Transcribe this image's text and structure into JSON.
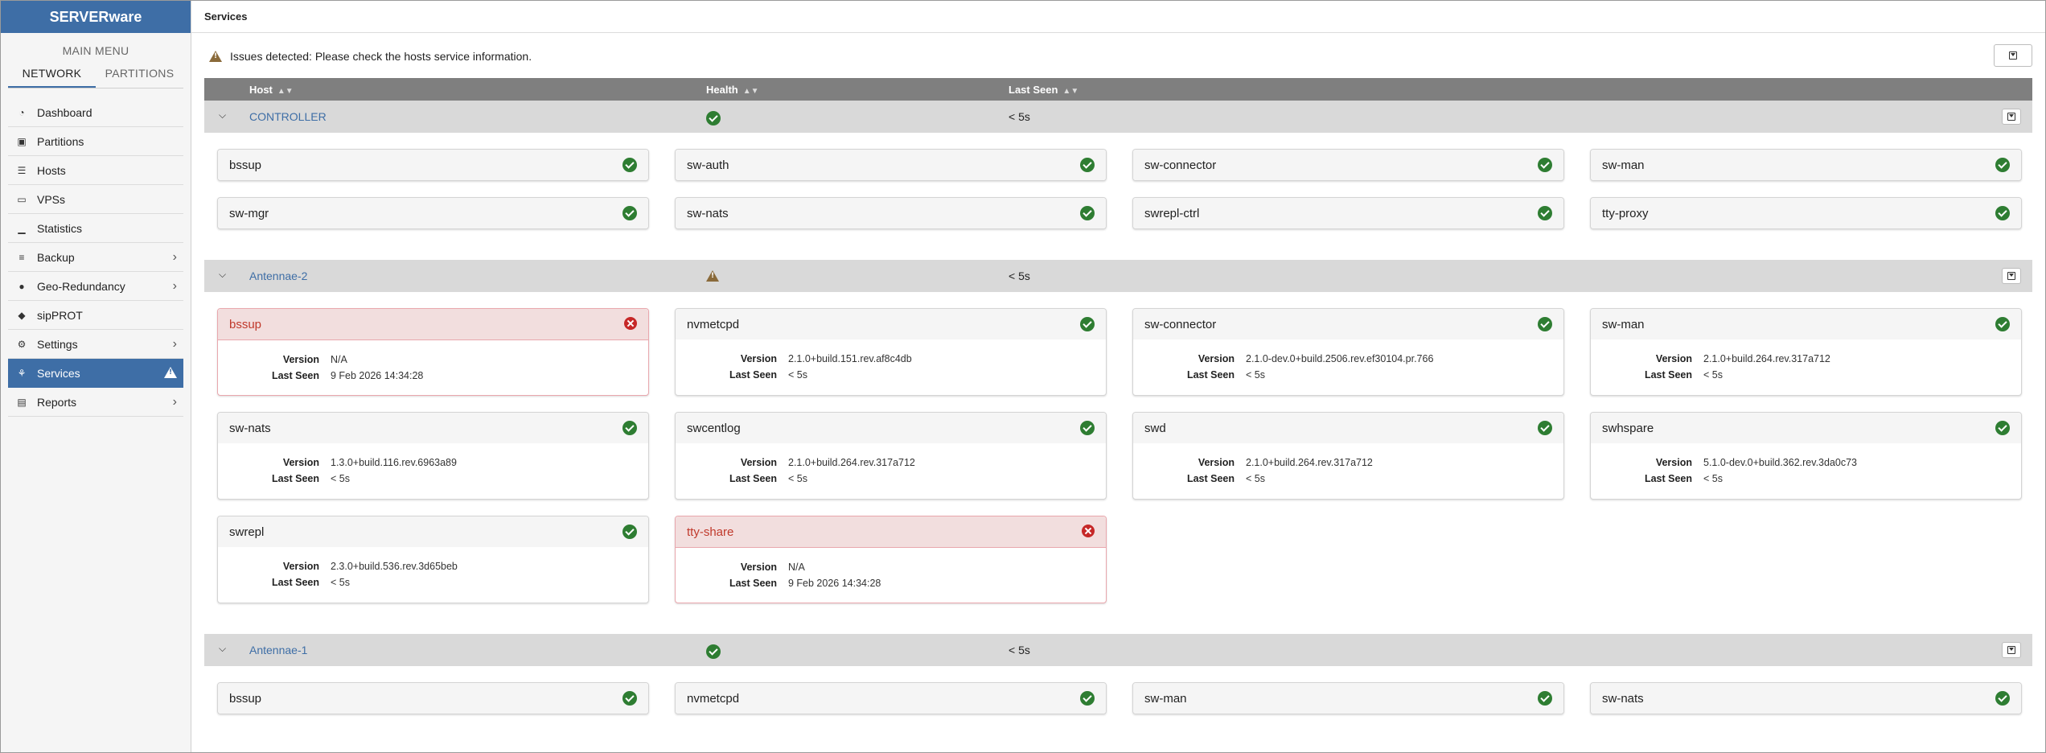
{
  "app": {
    "brand": "SERVERware"
  },
  "sidebar": {
    "menu_title": "MAIN MENU",
    "tabs": [
      {
        "label": "NETWORK",
        "active": true
      },
      {
        "label": "PARTITIONS",
        "active": false
      }
    ],
    "items": [
      {
        "label": "Dashboard",
        "icon": "dashboard-icon"
      },
      {
        "label": "Partitions",
        "icon": "partitions-icon"
      },
      {
        "label": "Hosts",
        "icon": "hosts-icon"
      },
      {
        "label": "VPSs",
        "icon": "laptop-icon"
      },
      {
        "label": "Statistics",
        "icon": "chart-icon"
      },
      {
        "label": "Backup",
        "icon": "database-icon",
        "submenu": true
      },
      {
        "label": "Geo-Redundancy",
        "icon": "globe-icon",
        "submenu": true
      },
      {
        "label": "sipPROT",
        "icon": "shield-icon"
      },
      {
        "label": "Settings",
        "icon": "gears-icon",
        "submenu": true
      },
      {
        "label": "Services",
        "icon": "services-icon",
        "active": true,
        "warning": true
      },
      {
        "label": "Reports",
        "icon": "report-icon",
        "submenu": true
      }
    ]
  },
  "header": {
    "title": "Services"
  },
  "alert": {
    "text": "Issues detected: Please check the hosts service information."
  },
  "table": {
    "columns": {
      "host": "Host",
      "health": "Health",
      "last_seen": "Last Seen"
    }
  },
  "hosts": [
    {
      "name": "CONTROLLER",
      "health": "ok",
      "last_seen": "< 5s",
      "services": [
        {
          "name": "bssup",
          "status": "ok"
        },
        {
          "name": "sw-auth",
          "status": "ok"
        },
        {
          "name": "sw-connector",
          "status": "ok"
        },
        {
          "name": "sw-man",
          "status": "ok"
        },
        {
          "name": "sw-mgr",
          "status": "ok"
        },
        {
          "name": "sw-nats",
          "status": "ok"
        },
        {
          "name": "swrepl-ctrl",
          "status": "ok"
        },
        {
          "name": "tty-proxy",
          "status": "ok"
        }
      ]
    },
    {
      "name": "Antennae-2",
      "health": "warning",
      "last_seen": "< 5s",
      "services": [
        {
          "name": "bssup",
          "status": "error",
          "version": "N/A",
          "last_seen": "9 Feb 2026 14:34:28"
        },
        {
          "name": "nvmetcpd",
          "status": "ok",
          "version": "2.1.0+build.151.rev.af8c4db",
          "last_seen": "< 5s"
        },
        {
          "name": "sw-connector",
          "status": "ok",
          "version": "2.1.0-dev.0+build.2506.rev.ef30104.pr.766",
          "last_seen": "< 5s"
        },
        {
          "name": "sw-man",
          "status": "ok",
          "version": "2.1.0+build.264.rev.317a712",
          "last_seen": "< 5s"
        },
        {
          "name": "sw-nats",
          "status": "ok",
          "version": "1.3.0+build.116.rev.6963a89",
          "last_seen": "< 5s"
        },
        {
          "name": "swcentlog",
          "status": "ok",
          "version": "2.1.0+build.264.rev.317a712",
          "last_seen": "< 5s"
        },
        {
          "name": "swd",
          "status": "ok",
          "version": "2.1.0+build.264.rev.317a712",
          "last_seen": "< 5s"
        },
        {
          "name": "swhspare",
          "status": "ok",
          "version": "5.1.0-dev.0+build.362.rev.3da0c73",
          "last_seen": "< 5s"
        },
        {
          "name": "swrepl",
          "status": "ok",
          "version": "2.3.0+build.536.rev.3d65beb",
          "last_seen": "< 5s"
        },
        {
          "name": "tty-share",
          "status": "error",
          "version": "N/A",
          "last_seen": "9 Feb 2026 14:34:28"
        }
      ]
    },
    {
      "name": "Antennae-1",
      "health": "ok",
      "last_seen": "< 5s",
      "services": [
        {
          "name": "bssup",
          "status": "ok"
        },
        {
          "name": "nvmetcpd",
          "status": "ok"
        },
        {
          "name": "sw-man",
          "status": "ok"
        },
        {
          "name": "sw-nats",
          "status": "ok"
        }
      ]
    }
  ],
  "labels": {
    "version": "Version",
    "last_seen": "Last Seen"
  }
}
